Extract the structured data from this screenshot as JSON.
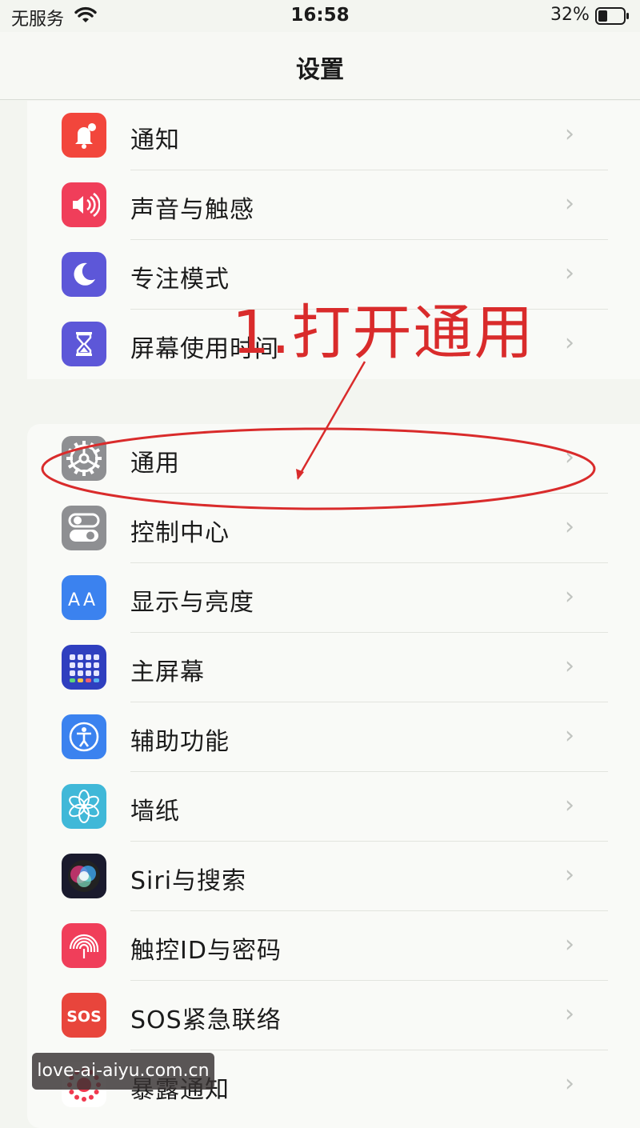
{
  "status_bar": {
    "carrier": "无服务",
    "time": "16:58",
    "battery": "32%"
  },
  "nav": {
    "title": "设置"
  },
  "group1": [
    {
      "label": "通知",
      "icon": "notification-bell-icon",
      "color": "#f2463c"
    },
    {
      "label": "声音与触感",
      "icon": "speaker-icon",
      "color": "#f03e5a"
    },
    {
      "label": "专注模式",
      "icon": "moon-icon",
      "color": "#5d57d8"
    },
    {
      "label": "屏幕使用时间",
      "icon": "hourglass-icon",
      "color": "#5d57d8"
    }
  ],
  "group2": [
    {
      "label": "通用",
      "icon": "gear-icon",
      "color": "#8e8f92"
    },
    {
      "label": "控制中心",
      "icon": "toggles-icon",
      "color": "#8e8f92"
    },
    {
      "label": "显示与亮度",
      "icon": "text-size-icon",
      "color": "#3b82ef"
    },
    {
      "label": "主屏幕",
      "icon": "home-screen-grid-icon",
      "color": "#2f3fbf"
    },
    {
      "label": "辅助功能",
      "icon": "accessibility-icon",
      "color": "#3b82ef"
    },
    {
      "label": "墙纸",
      "icon": "wallpaper-flower-icon",
      "color": "#40b8d8"
    },
    {
      "label": "Siri与搜索",
      "icon": "siri-icon",
      "color": "#1a1a2e"
    },
    {
      "label": "触控ID与密码",
      "icon": "fingerprint-icon",
      "color": "#f03e5a"
    },
    {
      "label": "SOS紧急联络",
      "icon": "sos-icon",
      "color": "#e8453c"
    },
    {
      "label": "暴露通知",
      "icon": "exposure-notification-icon",
      "color": "#ffffff"
    }
  ],
  "annotation": {
    "text": "1.打开通用",
    "color": "#d92b2b"
  },
  "watermark": "love-ai-aiyu.com.cn"
}
